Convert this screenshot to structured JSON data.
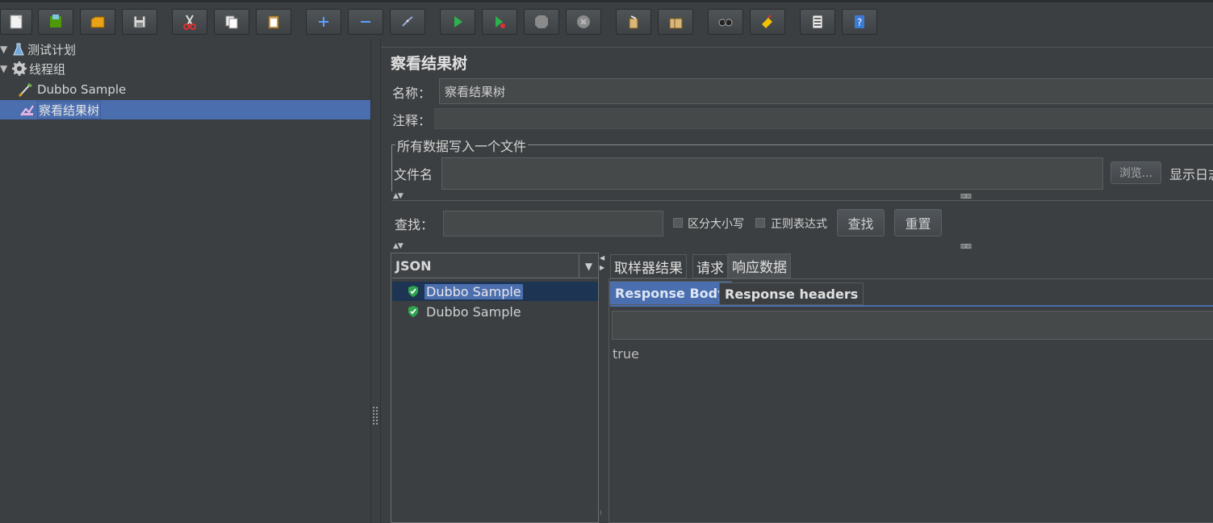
{
  "toolbar": {
    "buttons": [
      {
        "name": "new-icon"
      },
      {
        "name": "templates-icon"
      },
      {
        "name": "open-icon"
      },
      {
        "name": "save-icon"
      },
      {
        "name": "cut-icon"
      },
      {
        "name": "copy-icon"
      },
      {
        "name": "paste-icon"
      },
      {
        "name": "expand-icon"
      },
      {
        "name": "collapse-icon"
      },
      {
        "name": "toggle-icon"
      },
      {
        "name": "start-icon"
      },
      {
        "name": "start-no-pauses-icon"
      },
      {
        "name": "stop-icon"
      },
      {
        "name": "shutdown-icon"
      },
      {
        "name": "clear-icon"
      },
      {
        "name": "clear-all-icon"
      },
      {
        "name": "search-icon"
      },
      {
        "name": "reset-search-icon"
      },
      {
        "name": "function-helper-icon"
      },
      {
        "name": "help-icon"
      }
    ]
  },
  "tree": {
    "items": [
      {
        "label": "测试计划",
        "icon": "test-plan-icon"
      },
      {
        "label": "线程组",
        "icon": "gear-icon"
      },
      {
        "label": "Dubbo Sample",
        "icon": "sampler-icon"
      },
      {
        "label": "察看结果树",
        "icon": "listener-icon",
        "selected": true
      }
    ]
  },
  "panel": {
    "title": "察看结果树",
    "name_label": "名称：",
    "name_value": "察看结果树",
    "comment_label": "注释：",
    "comment_value": "",
    "file_group_title": "所有数据写入一个文件",
    "filename_label": "文件名",
    "filename_value": "",
    "browse_button": "浏览...",
    "display_log_label": "显示日志内容",
    "search_label": "查找：",
    "search_value": "",
    "case_sensitive_label": "区分大小写",
    "regex_label": "正则表达式",
    "find_button": "查找",
    "reset_button": "重置"
  },
  "results": {
    "renderer": "JSON",
    "samples": [
      {
        "label": "Dubbo Sample",
        "selected": true,
        "icon": "success-shield-icon"
      },
      {
        "label": "Dubbo Sample",
        "selected": false,
        "icon": "success-shield-icon"
      }
    ],
    "tabs": [
      "取样器结果",
      "请求",
      "响应数据"
    ],
    "active_tab": "响应数据",
    "subtabs": [
      "Response Body",
      "Response headers"
    ],
    "active_subtab": "Response Body",
    "search_value": "",
    "response_body": "true"
  },
  "colors": {
    "background": "#3c3f41",
    "selection": "#4b6eaf",
    "field": "#45494a",
    "success": "#2ea44f"
  }
}
